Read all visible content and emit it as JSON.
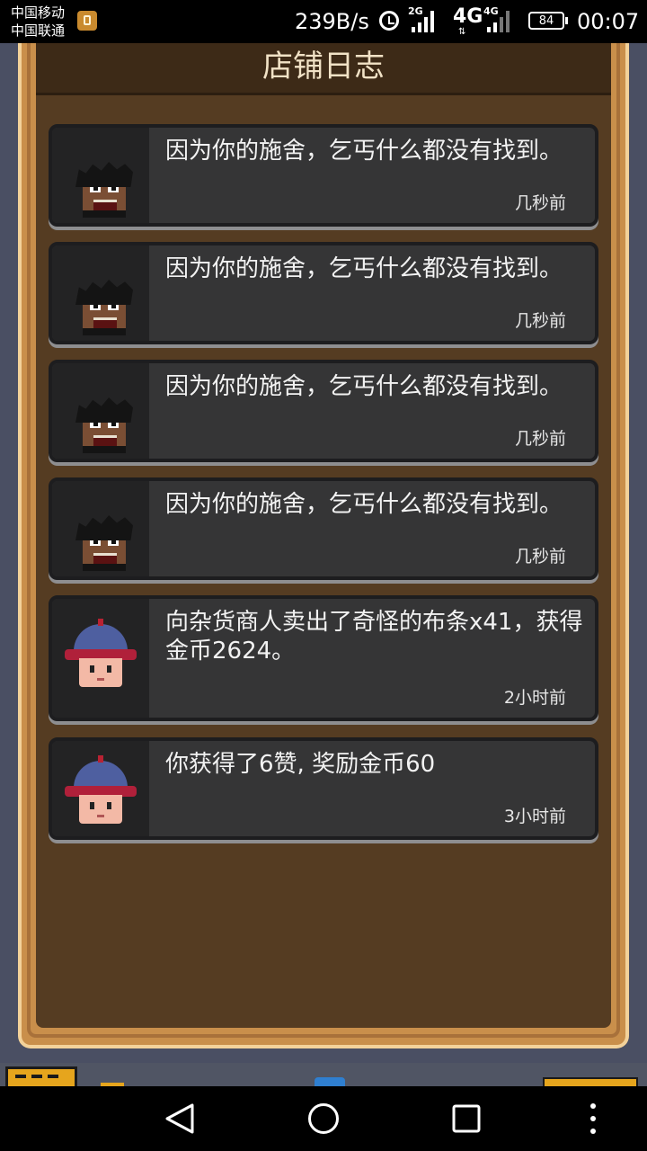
{
  "status_bar": {
    "carrier_1": "中国移动",
    "carrier_2": "中国联通",
    "net_speed": "239B/s",
    "signal_1_type": "2G",
    "signal_2_type": "4G",
    "lte": "4G",
    "battery": "84",
    "time": "00:07"
  },
  "panel": {
    "title": "店铺日志"
  },
  "log_entries": [
    {
      "avatar": "beggar-avatar",
      "text": "因为你的施舍，乞丐什么都没有找到。",
      "time": "几秒前"
    },
    {
      "avatar": "beggar-avatar",
      "text": "因为你的施舍，乞丐什么都没有找到。",
      "time": "几秒前"
    },
    {
      "avatar": "beggar-avatar",
      "text": "因为你的施舍，乞丐什么都没有找到。",
      "time": "几秒前"
    },
    {
      "avatar": "beggar-avatar",
      "text": "因为你的施舍，乞丐什么都没有找到。",
      "time": "几秒前"
    },
    {
      "avatar": "merchant-avatar",
      "text": "向杂货商人卖出了奇怪的布条x41，获得金币2624。",
      "time": "2小时前"
    },
    {
      "avatar": "merchant-avatar",
      "text": "你获得了6赞, 奖励金币60",
      "time": "3小时前"
    }
  ],
  "nav_bar": {
    "back": "back-icon",
    "home": "home-icon",
    "recents": "recents-icon",
    "menu": "more-vert-icon"
  },
  "colors": {
    "panel_bg": "#553c22",
    "frame": "#c98f4b",
    "card_bg": "#353536",
    "title_text": "#f1e2c6"
  }
}
